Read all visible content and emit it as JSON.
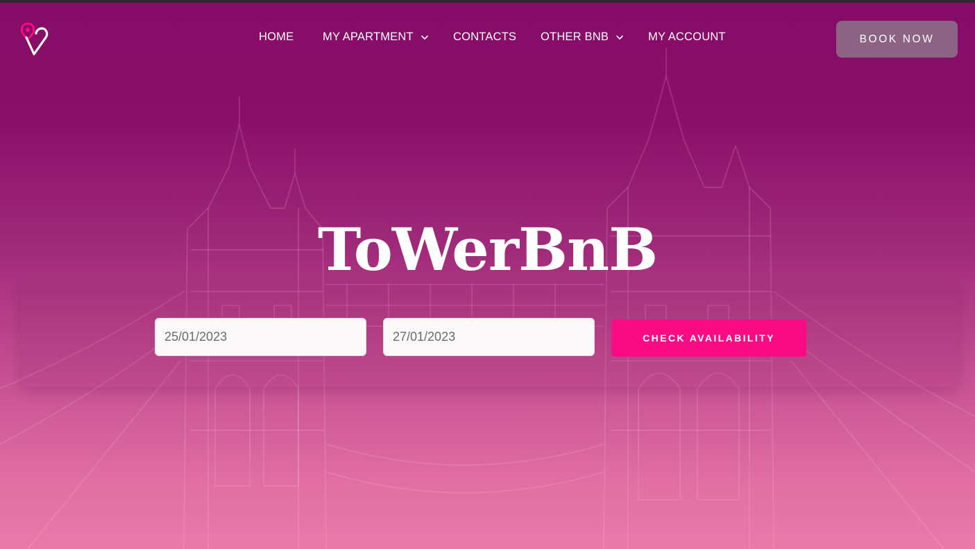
{
  "brand": {
    "name": "ToWerBnB",
    "logo_icon": "map-pin-heart-icon",
    "accent_color": "#fb0b84",
    "background_top": "#850c67",
    "background_bottom": "#e97aa8"
  },
  "nav": {
    "items": [
      {
        "label": "HOME",
        "has_dropdown": false
      },
      {
        "label": "MY APARTMENT",
        "has_dropdown": true,
        "icon": "chevron-down-icon"
      },
      {
        "label": "CONTACTS",
        "has_dropdown": false
      },
      {
        "label": "OTHER BNB",
        "has_dropdown": true,
        "icon": "chevron-down-icon"
      },
      {
        "label": "MY ACCOUNT",
        "has_dropdown": false
      }
    ],
    "cta_label": "BOOK NOW",
    "cta_color": "#8d6384"
  },
  "hero": {
    "title": "ToWerBnB",
    "background_illustration": "tower-bridge-sketch"
  },
  "booking": {
    "checkin_value": "25/01/2023",
    "checkout_value": "27/01/2023",
    "check_label": "CHECK AVAILABILITY"
  }
}
